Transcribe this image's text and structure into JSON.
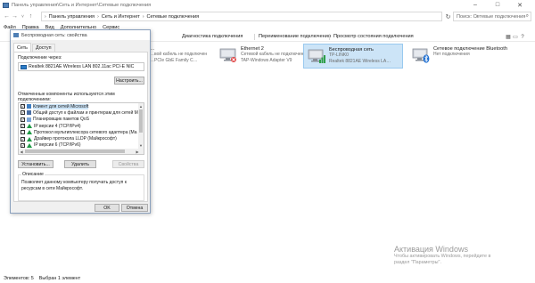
{
  "window": {
    "title": "Панель управления\\Сеть и Интернет\\Сетевые подключения",
    "minimize": "–",
    "maximize": "□",
    "close": "✕"
  },
  "address": {
    "crumbs": [
      "Панель управления",
      "Сеть и Интернет",
      "Сетевые подключения"
    ],
    "separator": "›",
    "search_placeholder": "Поиск: Сетевые подключения"
  },
  "menu": [
    "Файл",
    "Правка",
    "Вид",
    "Дополнительно",
    "Сервис"
  ],
  "commands": [
    "Диагностика подключения",
    "Переименование подключения",
    "Просмотр состояния подключения"
  ],
  "connections": [
    {
      "name": "…",
      "line1": "…вой кабель не подключен",
      "line2": "…PCIe GbE Family C…",
      "selected": false
    },
    {
      "name": "Ethernet 2",
      "line1": "Сетевой кабель не подключен",
      "line2": "TAP-Windows Adapter V9",
      "selected": false
    },
    {
      "name": "Беспроводная сеть",
      "line1": "TP-LINK0",
      "line2": "Realtek 8821AE Wireless LA…",
      "selected": true
    },
    {
      "name": "Сетевое подключение Bluetooth",
      "line1": "Нет подключения",
      "line2": "",
      "selected": false
    }
  ],
  "dialog": {
    "title": "Беспроводная сеть: свойства",
    "tabs": [
      "Сеть",
      "Доступ"
    ],
    "connect_via_label": "Подключение через:",
    "adapter": "Realtek 8821AE Wireless LAN 802.11ac PCI-E NIC",
    "configure_button": "Настроить...",
    "components_label": "Отмеченные компоненты используются этим подключением:",
    "components": [
      {
        "text": "Клиент для сетей Microsoft",
        "checked": true,
        "icon": "net",
        "selected": true
      },
      {
        "text": "Общий доступ к файлам и принтерам для сетей Mi",
        "checked": true,
        "icon": "share",
        "selected": false
      },
      {
        "text": "Планировщик пакетов QoS",
        "checked": true,
        "icon": "sched",
        "selected": false
      },
      {
        "text": "IP версии 4 (TCP/IPv4)",
        "checked": true,
        "icon": "proto",
        "selected": false
      },
      {
        "text": "Протокол мультиплексора сетевого адаптера (Ма",
        "checked": false,
        "icon": "proto",
        "selected": false
      },
      {
        "text": "Драйвер протокола LLDP (Майкрософт)",
        "checked": true,
        "icon": "proto",
        "selected": false
      },
      {
        "text": "IP версии 6 (TCP/IPv6)",
        "checked": true,
        "icon": "proto",
        "selected": false
      }
    ],
    "install_button": "Установить...",
    "remove_button": "Удалить",
    "properties_button": "Свойства",
    "description_label": "Описание",
    "description_text": "Позволяет данному компьютеру получать доступ к ресурсам в сети Майкрософт.",
    "ok_button": "OK",
    "cancel_button": "Отмена"
  },
  "status": {
    "items_count": "Элементов: 5",
    "selected_count": "Выбран 1 элемент"
  },
  "watermark": {
    "title": "Активация Windows",
    "line1": "Чтобы активировать Windows, перейдите в",
    "line2": "раздел \"Параметры\"."
  }
}
